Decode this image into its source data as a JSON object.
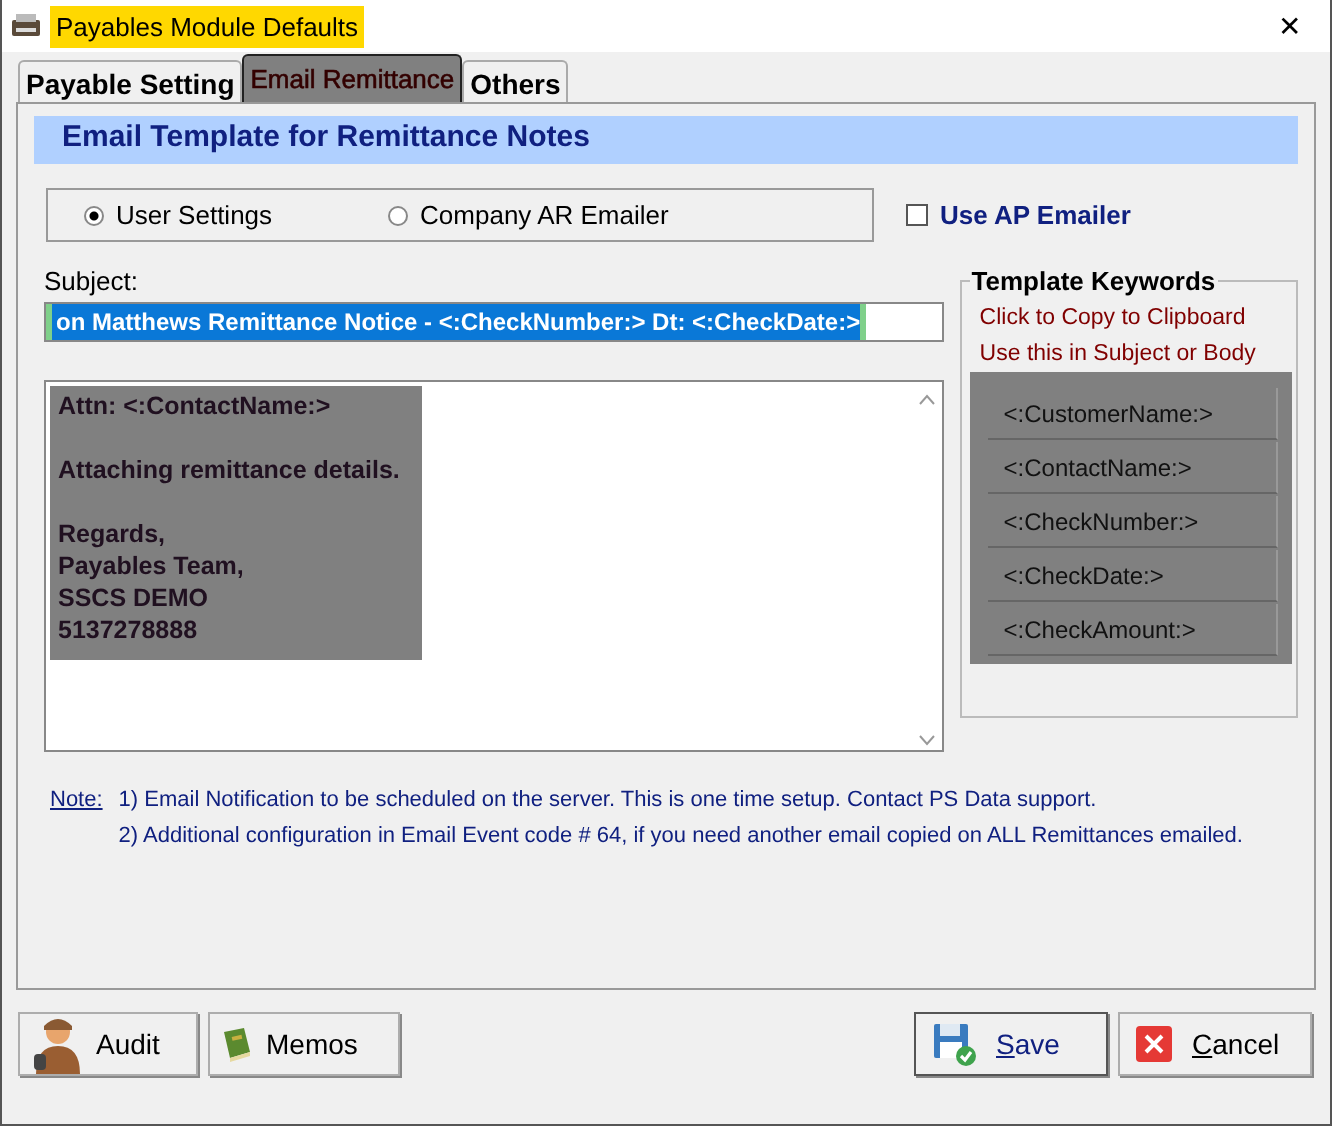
{
  "window": {
    "title": "Payables Module Defaults",
    "close": "✕"
  },
  "tabs": [
    {
      "label": "Payable Setting",
      "selected": false
    },
    {
      "label": "Email Remittance",
      "selected": true
    },
    {
      "label": "Others",
      "selected": false
    }
  ],
  "header": "Email Template for Remittance Notes",
  "source_options": [
    {
      "label": "User Settings",
      "selected": true
    },
    {
      "label": "Company AR Emailer",
      "selected": false
    }
  ],
  "use_ap_emailer": {
    "label": "Use AP Emailer",
    "checked": false
  },
  "subject": {
    "label": "Subject:",
    "value": "on Matthews Remittance Notice - <:CheckNumber:> Dt: <:CheckDate:>"
  },
  "body": {
    "paragraphs": [
      [
        "Attn: <:ContactName:>"
      ],
      [
        "Attaching remittance details."
      ],
      [
        "Regards,",
        "Payables Team,",
        "SSCS DEMO",
        "5137278888"
      ]
    ]
  },
  "keywords": {
    "title": "Template Keywords",
    "hints": [
      "Click to Copy to Clipboard",
      "Use this in Subject or Body"
    ],
    "items": [
      "<:CustomerName:>",
      "<:ContactName:>",
      "<:CheckNumber:>",
      "<:CheckDate:>",
      "<:CheckAmount:>"
    ]
  },
  "note": {
    "label": "Note:",
    "lines": [
      "1) Email Notification to be scheduled on the server. This is one time setup. Contact PS Data support.",
      "2) Additional configuration in Email Event code # 64, if you need another email copied on ALL Remittances emailed."
    ]
  },
  "buttons": [
    {
      "kind": "audit",
      "label": "Audit"
    },
    {
      "kind": "memos",
      "label": "Memos"
    },
    {
      "kind": "save",
      "key": "S",
      "rest": "ave"
    },
    {
      "kind": "cancel",
      "key": "C",
      "rest": "ancel"
    }
  ]
}
